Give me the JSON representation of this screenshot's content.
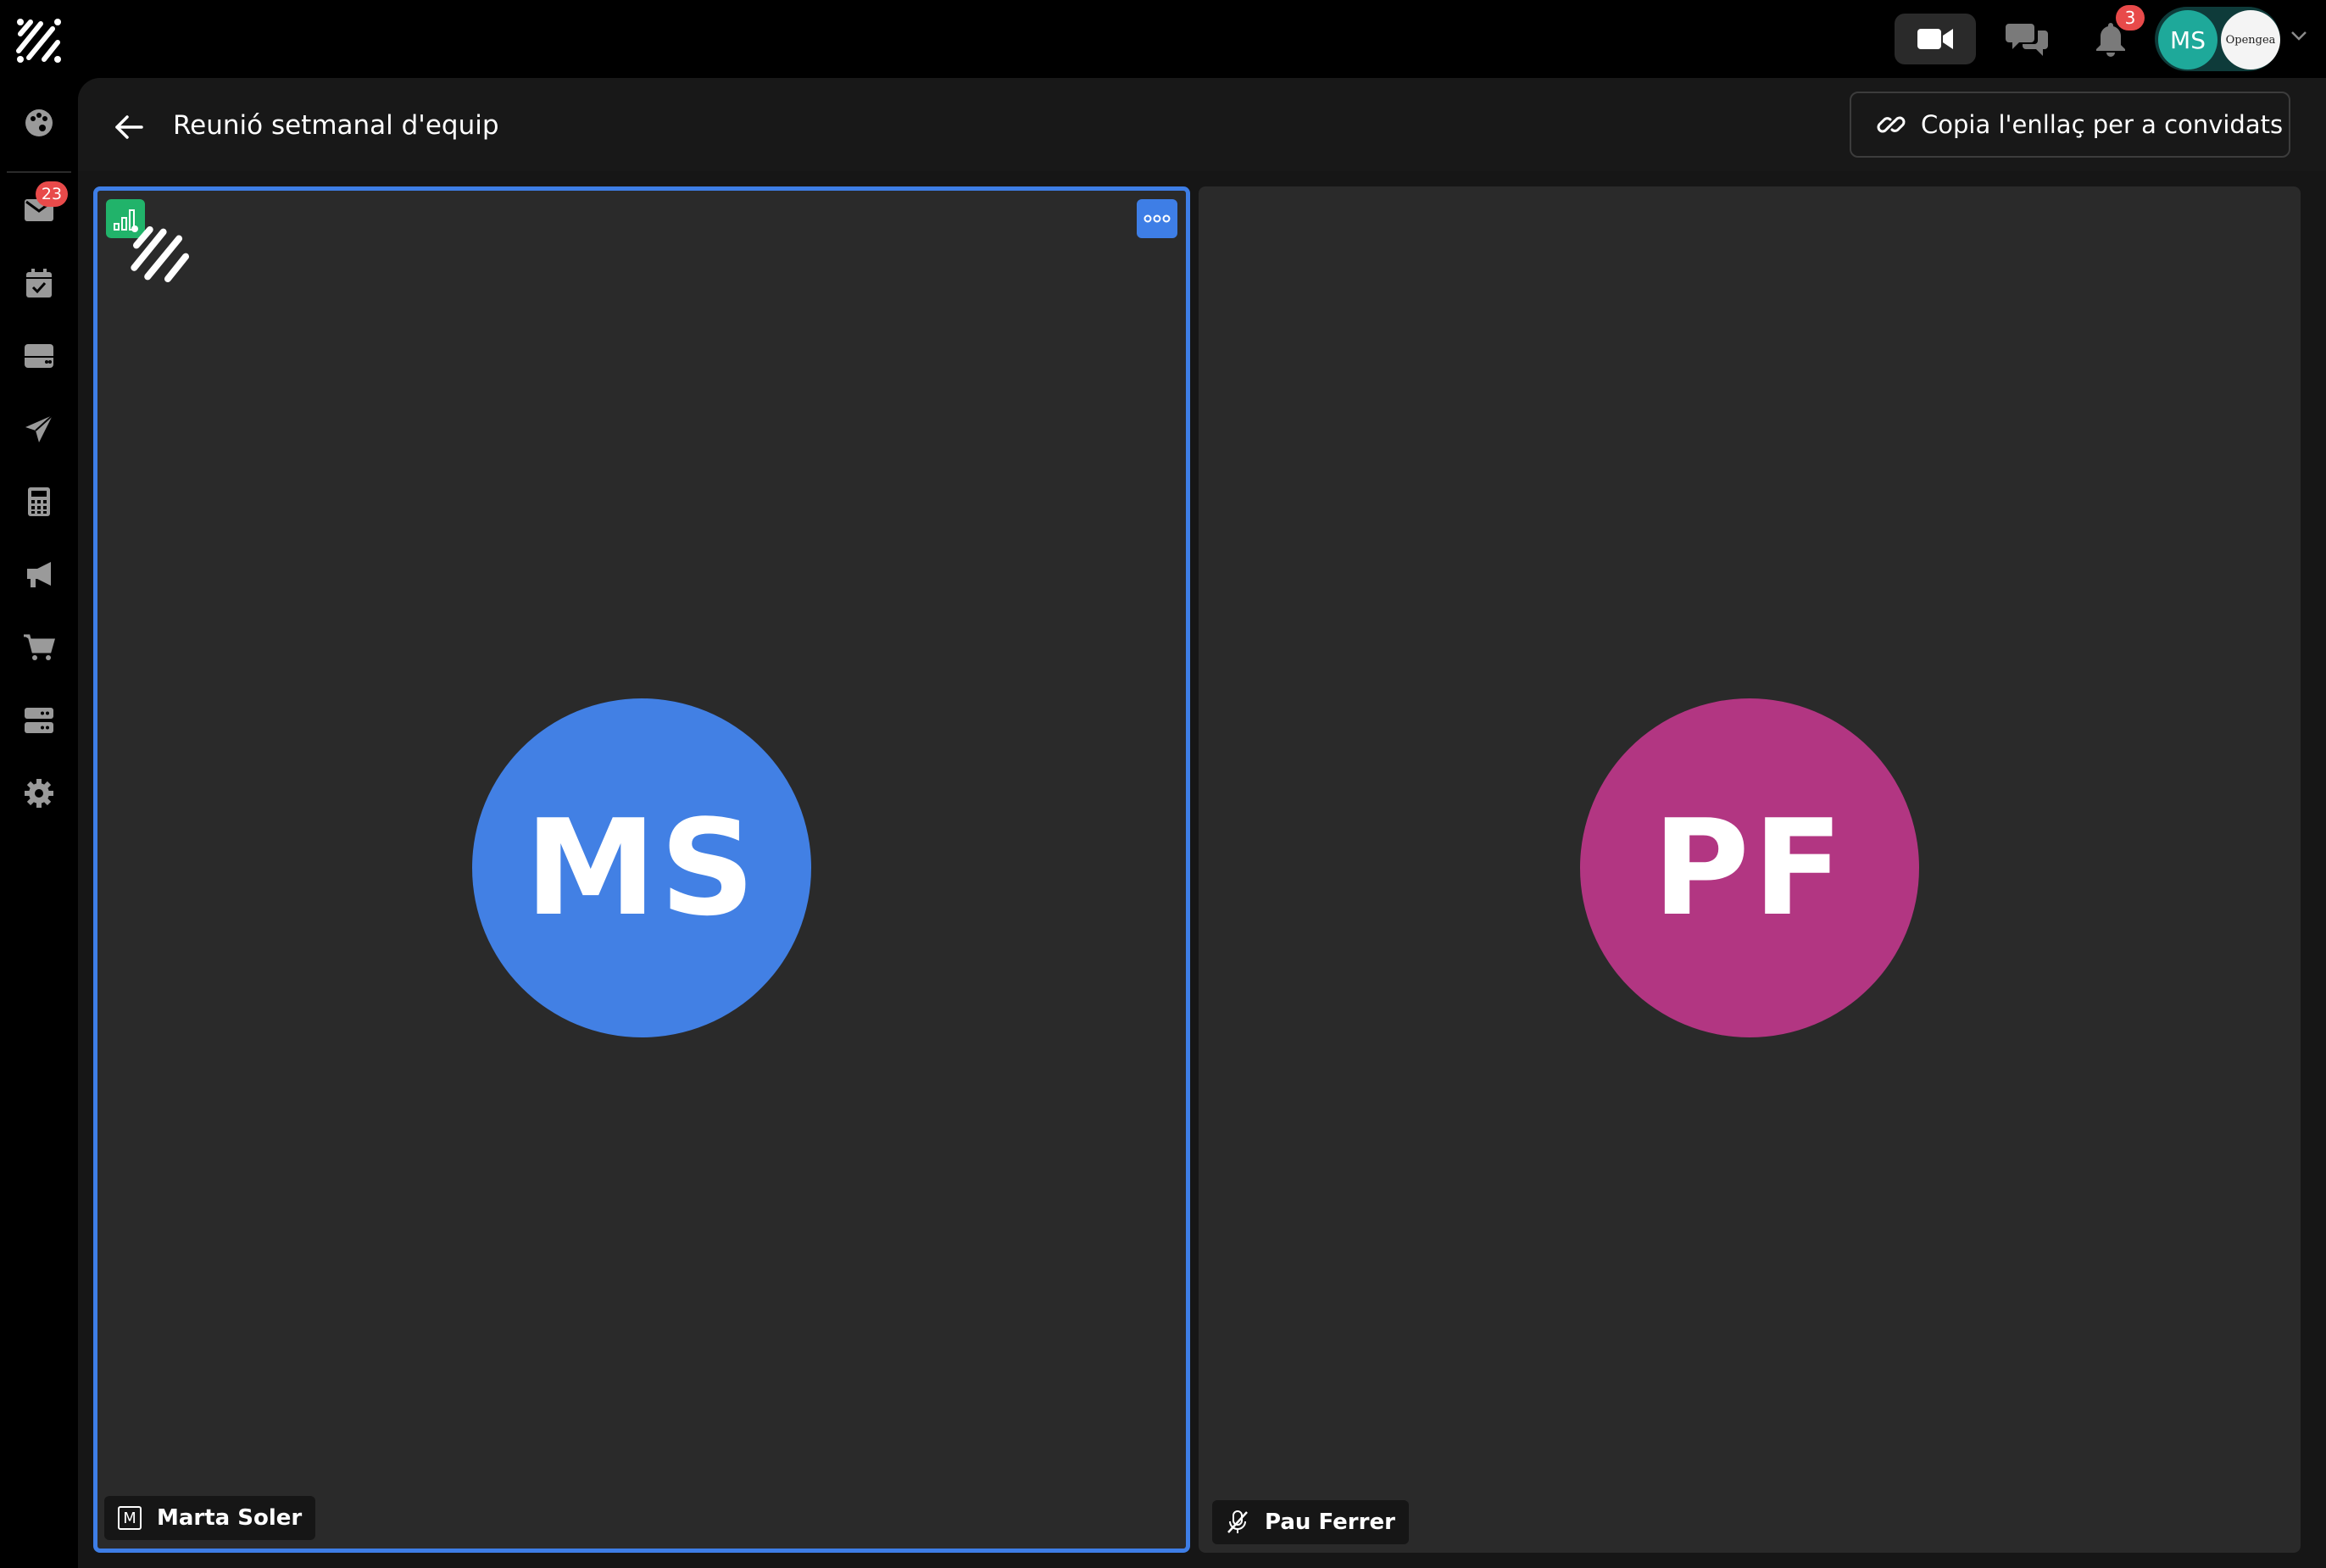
{
  "topbar": {
    "brand_icon": "brand-logo",
    "video_icon": "video-camera-icon",
    "chat_icon": "chat-bubbles-icon",
    "notifications_icon": "bell-icon",
    "notifications_count": "3",
    "user_initials": "MS",
    "user_color": "#1ea99a",
    "org_name": "Opengea",
    "menu_icon": "chevron-down-icon"
  },
  "sidebar": {
    "items": [
      {
        "name": "dashboard",
        "icon": "palette-icon"
      },
      {
        "name": "mail",
        "icon": "envelope-icon",
        "badge": "23"
      },
      {
        "name": "calendar",
        "icon": "calendar-check-icon"
      },
      {
        "name": "inbox",
        "icon": "inbox-tray-icon"
      },
      {
        "name": "send",
        "icon": "paper-plane-icon"
      },
      {
        "name": "calculator",
        "icon": "calculator-icon"
      },
      {
        "name": "marketing",
        "icon": "megaphone-icon"
      },
      {
        "name": "shop",
        "icon": "shopping-cart-icon"
      },
      {
        "name": "servers",
        "icon": "server-icon"
      },
      {
        "name": "settings",
        "icon": "gear-icon"
      }
    ]
  },
  "header": {
    "back_icon": "arrow-left-icon",
    "title": "Reunió setmanal d'equip",
    "copy_link_label": "Copia l'enllaç per a convidats",
    "copy_link_icon": "link-icon"
  },
  "participants": [
    {
      "initials": "MS",
      "name": "Marta Soler",
      "avatar_color": "#4280e4",
      "active_speaker": true,
      "status_icon": "m-badge-icon",
      "connection_icon": "signal-bars-icon",
      "more_icon": "more-options-icon"
    },
    {
      "initials": "PF",
      "name": "Pau Ferrer",
      "avatar_color": "#b23682",
      "active_speaker": false,
      "status_icon": "microphone-muted-icon"
    }
  ],
  "colors": {
    "accent": "#3e7ee6",
    "badge": "#e84a4a",
    "signal_good": "#21b36a",
    "tile_bg": "#2a2a2a",
    "app_bg": "#000000"
  }
}
